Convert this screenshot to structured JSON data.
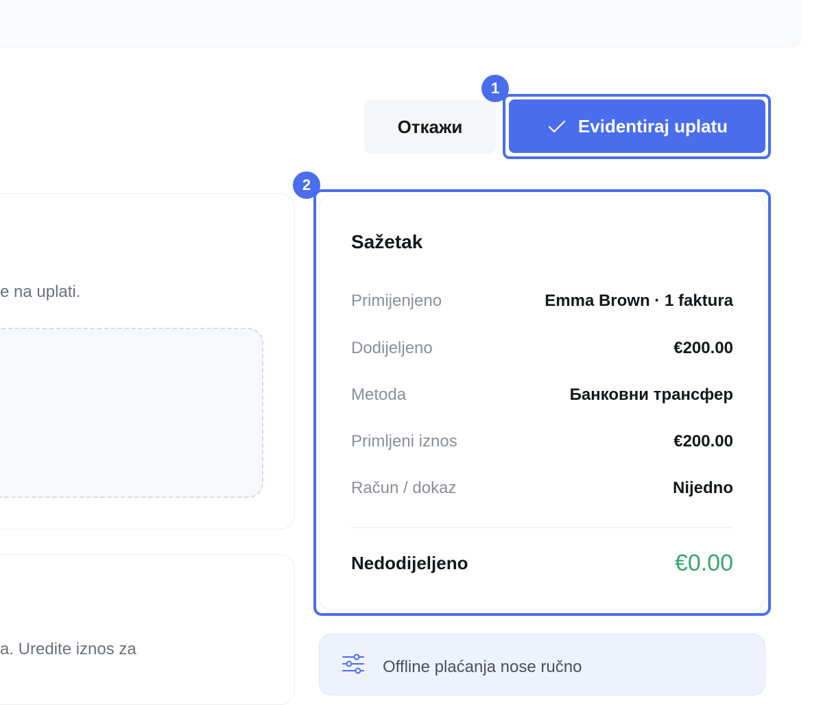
{
  "actions": {
    "cancel_label": "Откажи",
    "primary_label": "Evidentiraj uplatu"
  },
  "annotations": {
    "badge_1": "1",
    "badge_2": "2"
  },
  "left_panel": {
    "hint_1": "e na uplati.",
    "hint_2": "a. Uredite iznos za"
  },
  "summary": {
    "title": "Sažetak",
    "rows": [
      {
        "label": "Primijenjeno",
        "value": "Emma Brown · 1 faktura"
      },
      {
        "label": "Dodijeljeno",
        "value": "€200.00"
      },
      {
        "label": "Metoda",
        "value": "Банковни трансфер"
      },
      {
        "label": "Primljeni iznos",
        "value": "€200.00"
      },
      {
        "label": "Račun / dokaz",
        "value": "Nijedno"
      }
    ],
    "total_label": "Nedodijeljeno",
    "total_value": "€0.00"
  },
  "note": {
    "text": "Offline plaćanja nose ručno"
  },
  "colors": {
    "accent": "#4a6ded",
    "success": "#3aa46b"
  }
}
